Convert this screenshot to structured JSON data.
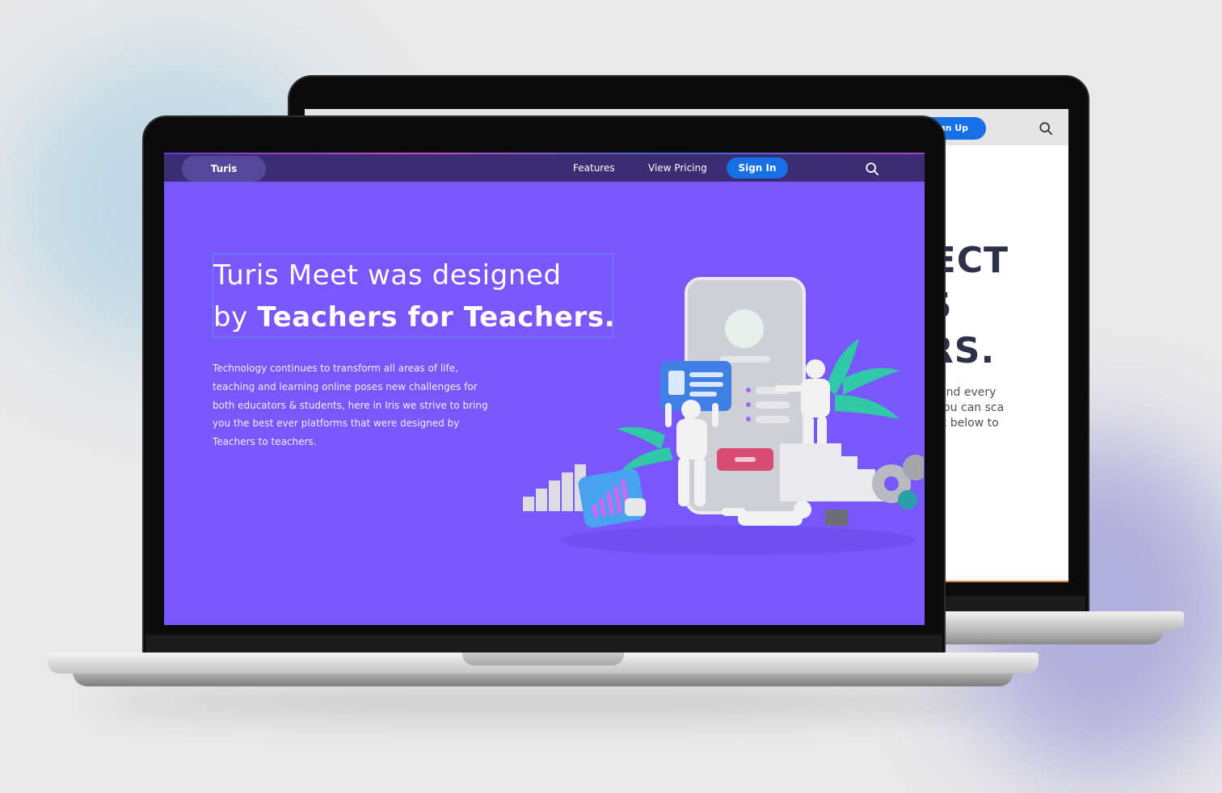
{
  "front": {
    "brand": "Turis",
    "nav": {
      "features": "Features",
      "pricing": "View Pricing",
      "signin": "Sign In"
    },
    "hero": {
      "title_line1": "Turis Meet was designed",
      "title_line2_prefix": "by ",
      "title_line2_bold": "Teachers for Teachers.",
      "paragraph": "Technology continues to transform all areas of life, teaching and learning online poses new challenges for both educators & students, here in Iris we strive to bring you the best ever platforms that were designed by Teachers to teachers."
    }
  },
  "back": {
    "signup": "Sign Up",
    "heading_lines": [
      "NNECT",
      "NTS",
      "HERS."
    ],
    "paragraph_lines": [
      "ery student and every",
      ". With Turis you can sca",
      "ck on the link below to"
    ]
  },
  "colors": {
    "hero_bg": "#7857fc",
    "nav_bg": "#3b2d74",
    "accent_blue": "#1670e8"
  },
  "icons": [
    "search-icon",
    "bar-chart-icon",
    "id-card-icon",
    "gear-icon"
  ]
}
